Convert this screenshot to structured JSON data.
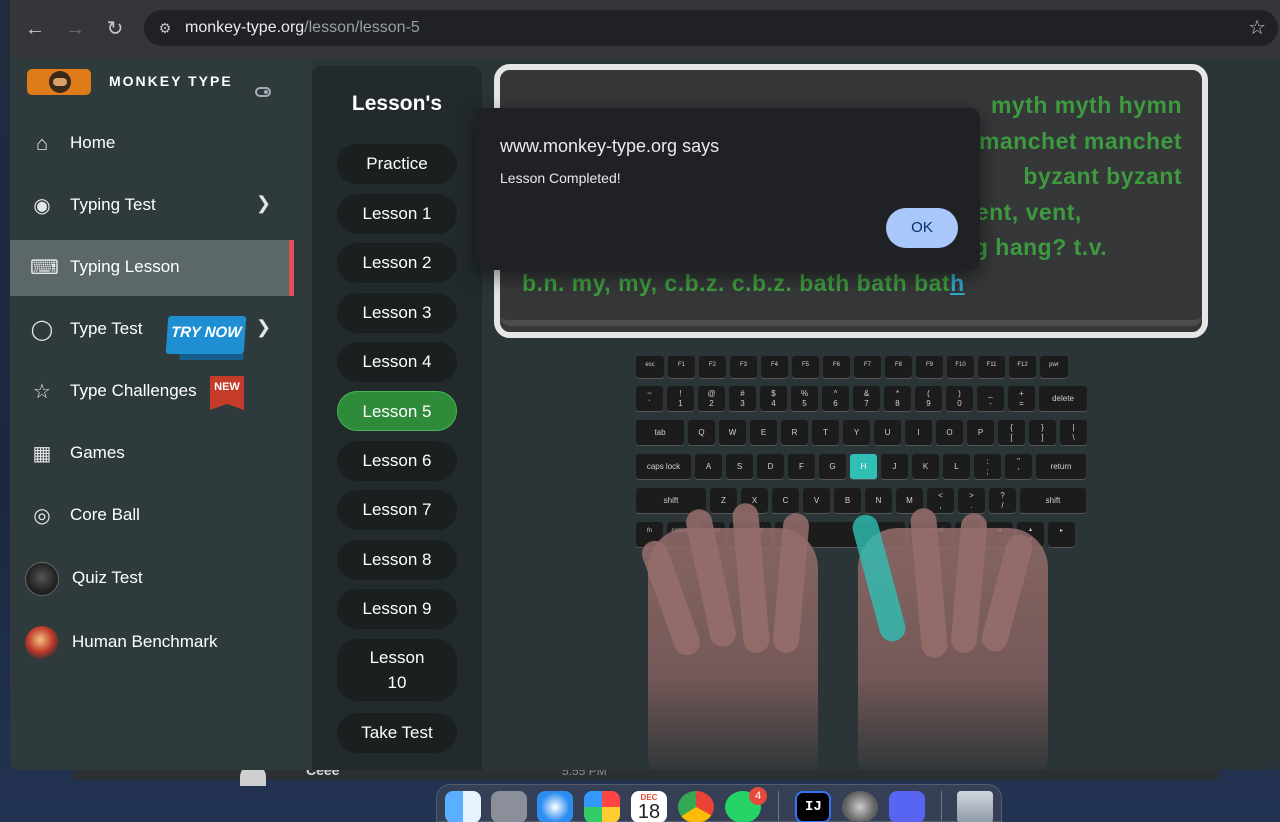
{
  "browser": {
    "url_host": "monkey-type.org",
    "url_path": "/lesson/lesson-5"
  },
  "sidebar": {
    "brand": "MONKEY TYPE",
    "items": [
      {
        "label": "Home",
        "icon": "home-icon"
      },
      {
        "label": "Typing Test",
        "icon": "github-cat-icon"
      },
      {
        "label": "Typing Lesson",
        "icon": "keyboard-icon"
      },
      {
        "label": "Type Test",
        "icon": "cat-icon"
      },
      {
        "label": "Type Challenges",
        "icon": "award-icon"
      },
      {
        "label": "Games",
        "icon": "grid-icon"
      },
      {
        "label": "Core Ball",
        "icon": "target-icon"
      },
      {
        "label": "Quiz Test",
        "icon": "quiz-avatar"
      },
      {
        "label": "Human Benchmark",
        "icon": "human-benchmark-avatar"
      }
    ],
    "try_now": "TRY NOW",
    "new_badge": "NEW"
  },
  "lessons": {
    "title": "Lesson's",
    "buttons": [
      "Practice",
      "Lesson 1",
      "Lesson 2",
      "Lesson 3",
      "Lesson 4",
      "Lesson 5",
      "Lesson 6",
      "Lesson 7",
      "Lesson 8",
      "Lesson 9",
      "Lesson 10",
      "Take Test"
    ],
    "active": "Lesson 5"
  },
  "typing": {
    "line1": "myth myth hymn",
    "line2": "manchet manchet",
    "line3": "byzant byzant",
    "line4": "byzant taxmon change change agent agent, vent,",
    "line5": "vent, max max max? next next next hang hang? t.v.",
    "line6_done": "b.n. my, my, c.b.z. c.b.z. bath bath bat",
    "line6_cursor": "h"
  },
  "dialog": {
    "title": "www.monkey-type.org says",
    "message": "Lesson Completed!",
    "ok": "OK"
  },
  "keyboard": {
    "highlight_key": "H",
    "row0": [
      "esc",
      "F1",
      "F2",
      "F3",
      "F4",
      "F5",
      "F6",
      "F7",
      "F8",
      "F9",
      "F10",
      "F11",
      "F12",
      "pwr"
    ],
    "row1": [
      "~\n`",
      "!\n1",
      "@\n2",
      "#\n3",
      "$\n4",
      "%\n5",
      "^\n6",
      "&\n7",
      "*\n8",
      "(\n9",
      ")\n0",
      "_\n-",
      "+\n=",
      "delete"
    ],
    "row2": [
      "tab",
      "Q",
      "W",
      "E",
      "R",
      "T",
      "Y",
      "U",
      "I",
      "O",
      "P",
      "{\n[",
      "}\n]",
      "|\n\\"
    ],
    "row3": [
      "caps lock",
      "A",
      "S",
      "D",
      "F",
      "G",
      "H",
      "J",
      "K",
      "L",
      ":\n;",
      "\"\n'",
      "return"
    ],
    "row4": [
      "shift",
      "Z",
      "X",
      "C",
      "V",
      "B",
      "N",
      "M",
      "<\n,",
      ">\n.",
      "?\n/",
      "shift"
    ],
    "row5": [
      "fn",
      "control",
      "option",
      "command",
      "",
      "command",
      "option",
      "◂",
      "▴\n▾",
      "▸"
    ]
  },
  "dock": {
    "calendar_month": "DEC",
    "calendar_day": "18",
    "whatsapp_badge": "4",
    "ij_label": "IJ"
  },
  "background_window": {
    "name": "Ceee",
    "time": "5:55 PM"
  }
}
